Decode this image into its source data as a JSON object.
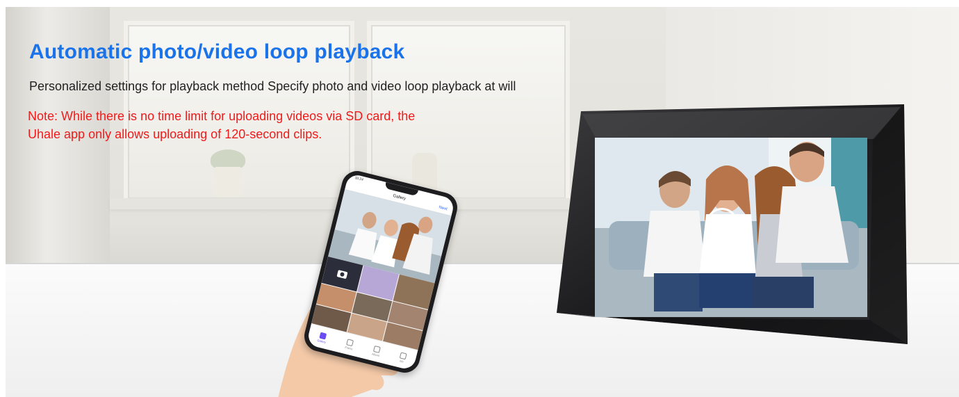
{
  "banner": {
    "title": "Automatic photo/video loop playback",
    "subtitle": "Personalized settings for playback method Specify photo and video loop playback at will",
    "note_line1": "Note: While there is no time limit for uploading videos via SD card, the",
    "note_line2": "Uhale app only allows uploading of 120-second clips.",
    "title_color": "#1a73e8",
    "note_color": "#f01a1a"
  },
  "phone": {
    "status_time": "10:24",
    "screen_title": "Gallery",
    "next_label": "Next",
    "tabs": [
      {
        "label": "Gallery",
        "icon": "gallery-icon",
        "active": true
      },
      {
        "label": "Frame",
        "icon": "frame-icon",
        "active": false
      },
      {
        "label": "Album",
        "icon": "album-icon",
        "active": false
      },
      {
        "label": "Me",
        "icon": "user-icon",
        "active": false
      }
    ]
  },
  "frame": {
    "overlay_icon": "play-icon"
  }
}
